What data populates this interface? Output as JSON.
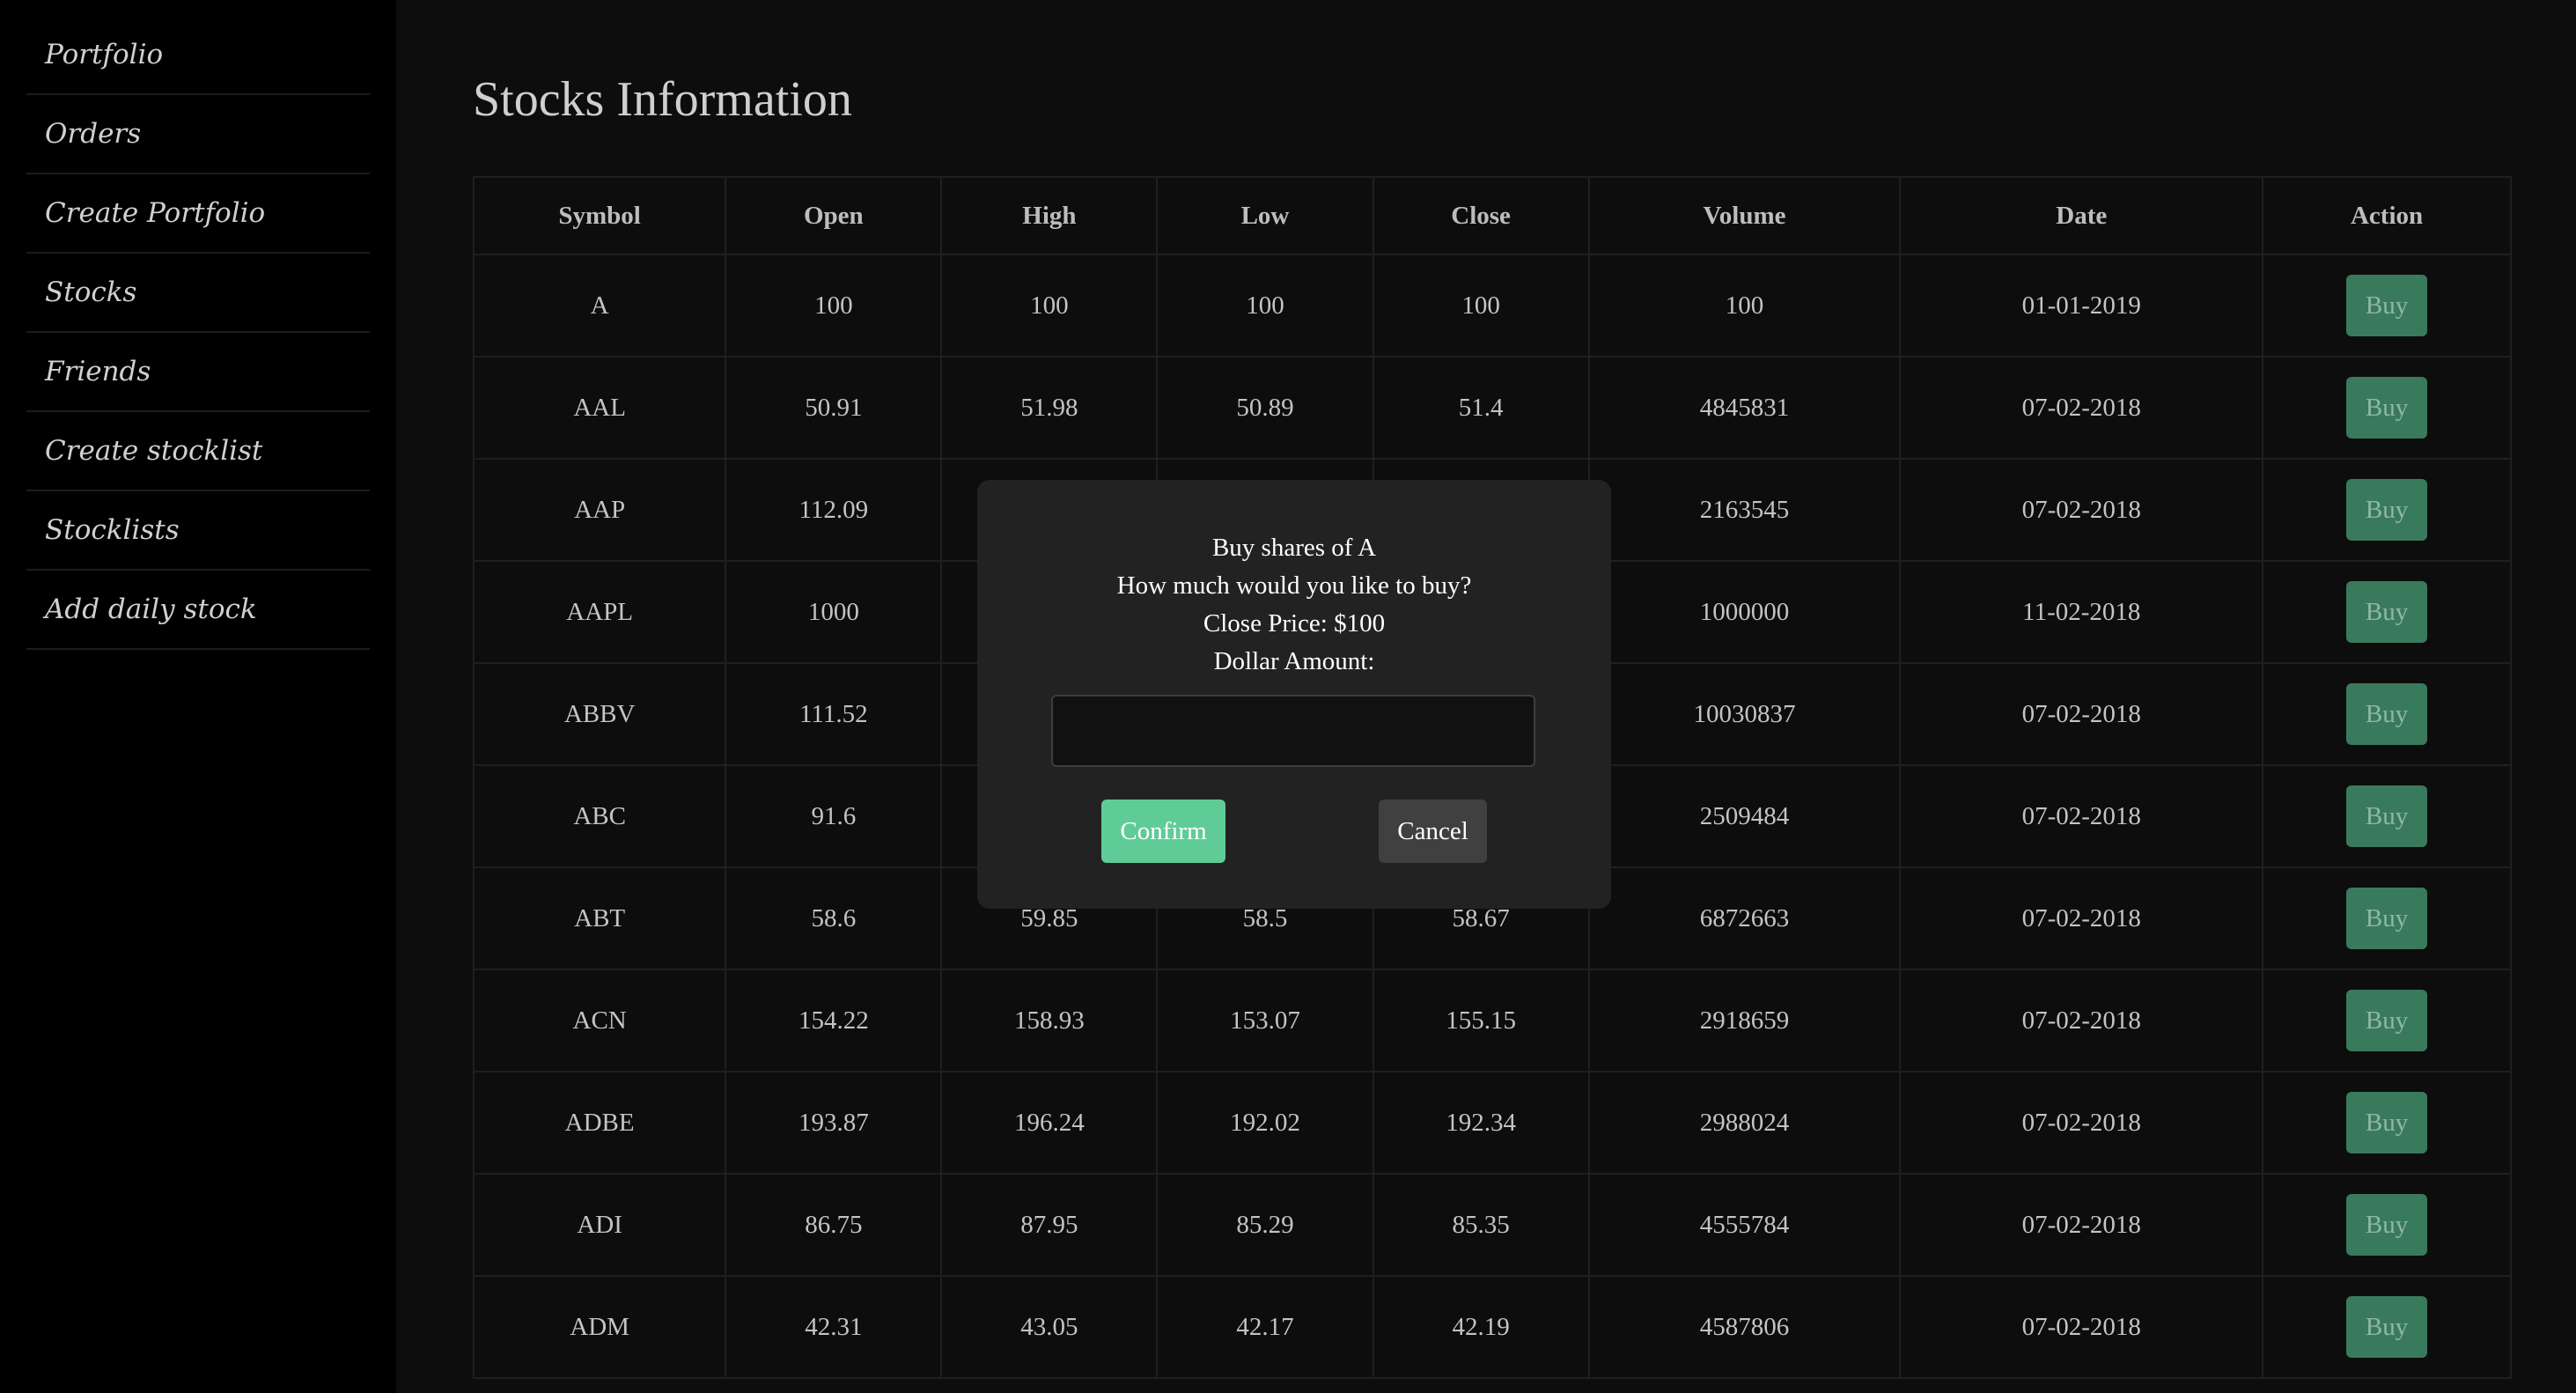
{
  "sidebar": {
    "items": [
      {
        "label": "Portfolio"
      },
      {
        "label": "Orders"
      },
      {
        "label": "Create Portfolio"
      },
      {
        "label": "Stocks"
      },
      {
        "label": "Friends"
      },
      {
        "label": "Create stocklist"
      },
      {
        "label": "Stocklists"
      },
      {
        "label": "Add daily stock"
      }
    ]
  },
  "main": {
    "title": "Stocks Information",
    "table": {
      "headers": [
        "Symbol",
        "Open",
        "High",
        "Low",
        "Close",
        "Volume",
        "Date",
        "Action"
      ],
      "action_label": "Buy",
      "rows": [
        [
          "A",
          "100",
          "100",
          "100",
          "100",
          "100",
          "01-01-2019"
        ],
        [
          "AAL",
          "50.91",
          "51.98",
          "50.89",
          "51.4",
          "4845831",
          "07-02-2018"
        ],
        [
          "AAP",
          "112.09",
          "",
          "",
          "",
          "2163545",
          "07-02-2018"
        ],
        [
          "AAPL",
          "1000",
          "",
          "",
          "",
          "1000000",
          "11-02-2018"
        ],
        [
          "ABBV",
          "111.52",
          "",
          "",
          "",
          "10030837",
          "07-02-2018"
        ],
        [
          "ABC",
          "91.6",
          "",
          "",
          "",
          "2509484",
          "07-02-2018"
        ],
        [
          "ABT",
          "58.6",
          "59.85",
          "58.5",
          "58.67",
          "6872663",
          "07-02-2018"
        ],
        [
          "ACN",
          "154.22",
          "158.93",
          "153.07",
          "155.15",
          "2918659",
          "07-02-2018"
        ],
        [
          "ADBE",
          "193.87",
          "196.24",
          "192.02",
          "192.34",
          "2988024",
          "07-02-2018"
        ],
        [
          "ADI",
          "86.75",
          "87.95",
          "85.29",
          "85.35",
          "4555784",
          "07-02-2018"
        ],
        [
          "ADM",
          "42.31",
          "43.05",
          "42.17",
          "42.19",
          "4587806",
          "07-02-2018"
        ]
      ]
    }
  },
  "modal": {
    "line1": "Buy shares of A",
    "line2": "How much would you like to buy?",
    "line3": "Close Price: $100",
    "line4": "Dollar Amount:",
    "amount_value": "",
    "confirm_label": "Confirm",
    "cancel_label": "Cancel"
  },
  "colors": {
    "buy_button": "#3a7a5c",
    "confirm_button": "#5fcc98",
    "cancel_button": "#404040",
    "modal_bg": "#222222"
  }
}
